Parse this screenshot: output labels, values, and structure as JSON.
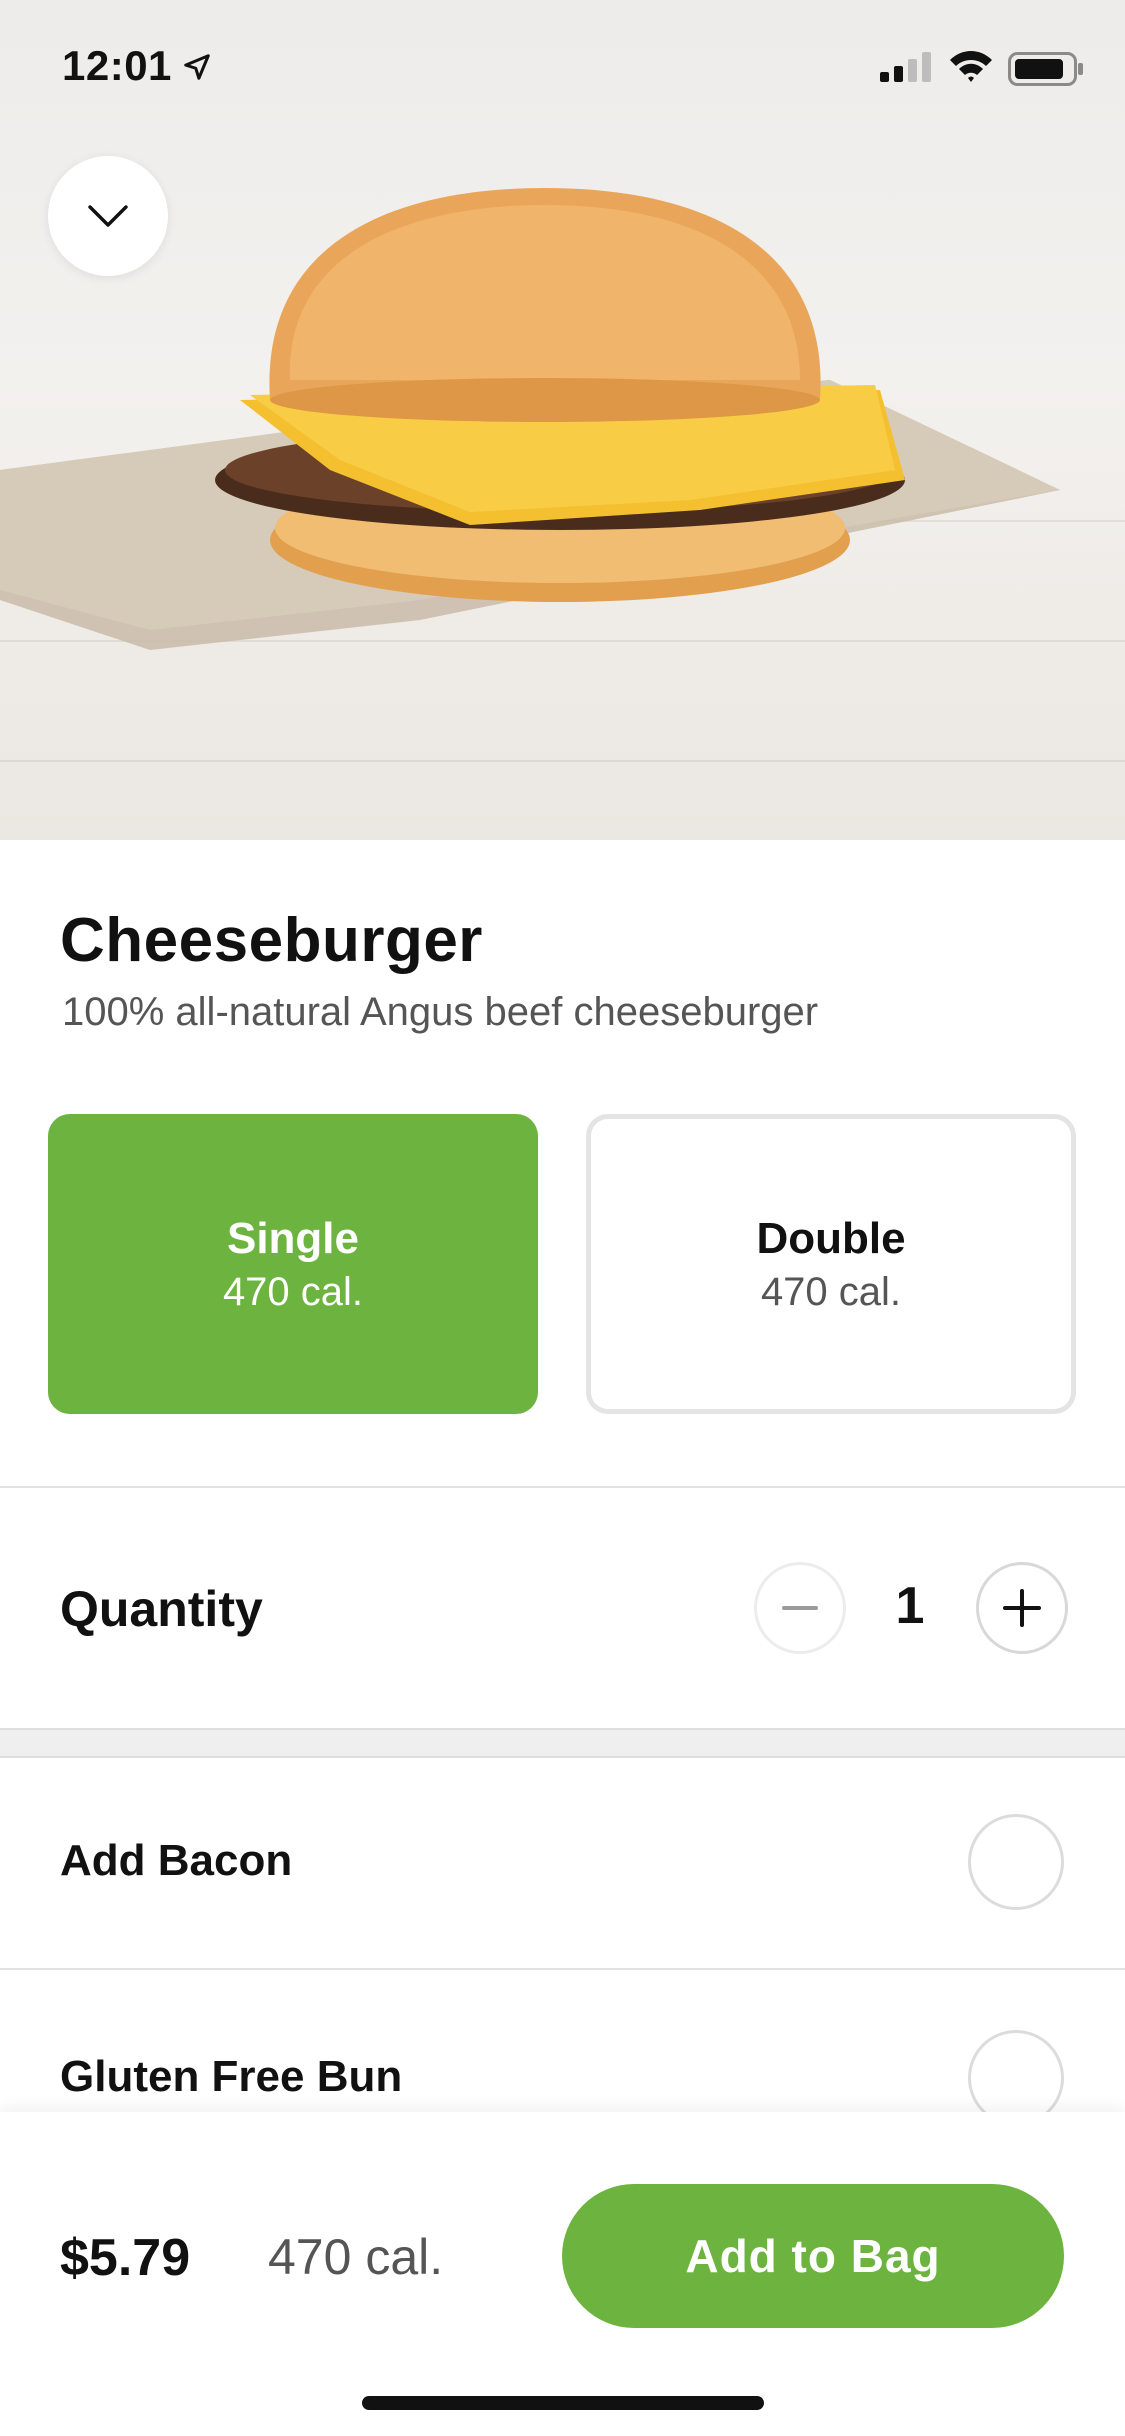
{
  "status_bar": {
    "time": "12:01"
  },
  "product": {
    "name": "Cheeseburger",
    "description": "100% all-natural Angus beef cheeseburger"
  },
  "size_options": [
    {
      "label": "Single",
      "calories": "470 cal.",
      "selected": true
    },
    {
      "label": "Double",
      "calories": "470 cal.",
      "selected": false
    }
  ],
  "quantity": {
    "label": "Quantity",
    "value": "1"
  },
  "addons": [
    {
      "label": "Add Bacon",
      "checked": false
    },
    {
      "label": "Gluten Free Bun",
      "checked": false
    }
  ],
  "footer": {
    "price": "$5.79",
    "calories": "470 cal.",
    "add_button": "Add to Bag"
  },
  "colors": {
    "accent": "#6db33f",
    "text": "#111111",
    "muted": "#555555"
  },
  "icons": [
    "location-arrow-icon",
    "cellular-signal-icon",
    "wifi-icon",
    "battery-icon",
    "chevron-down-icon",
    "minus-icon",
    "plus-icon"
  ]
}
